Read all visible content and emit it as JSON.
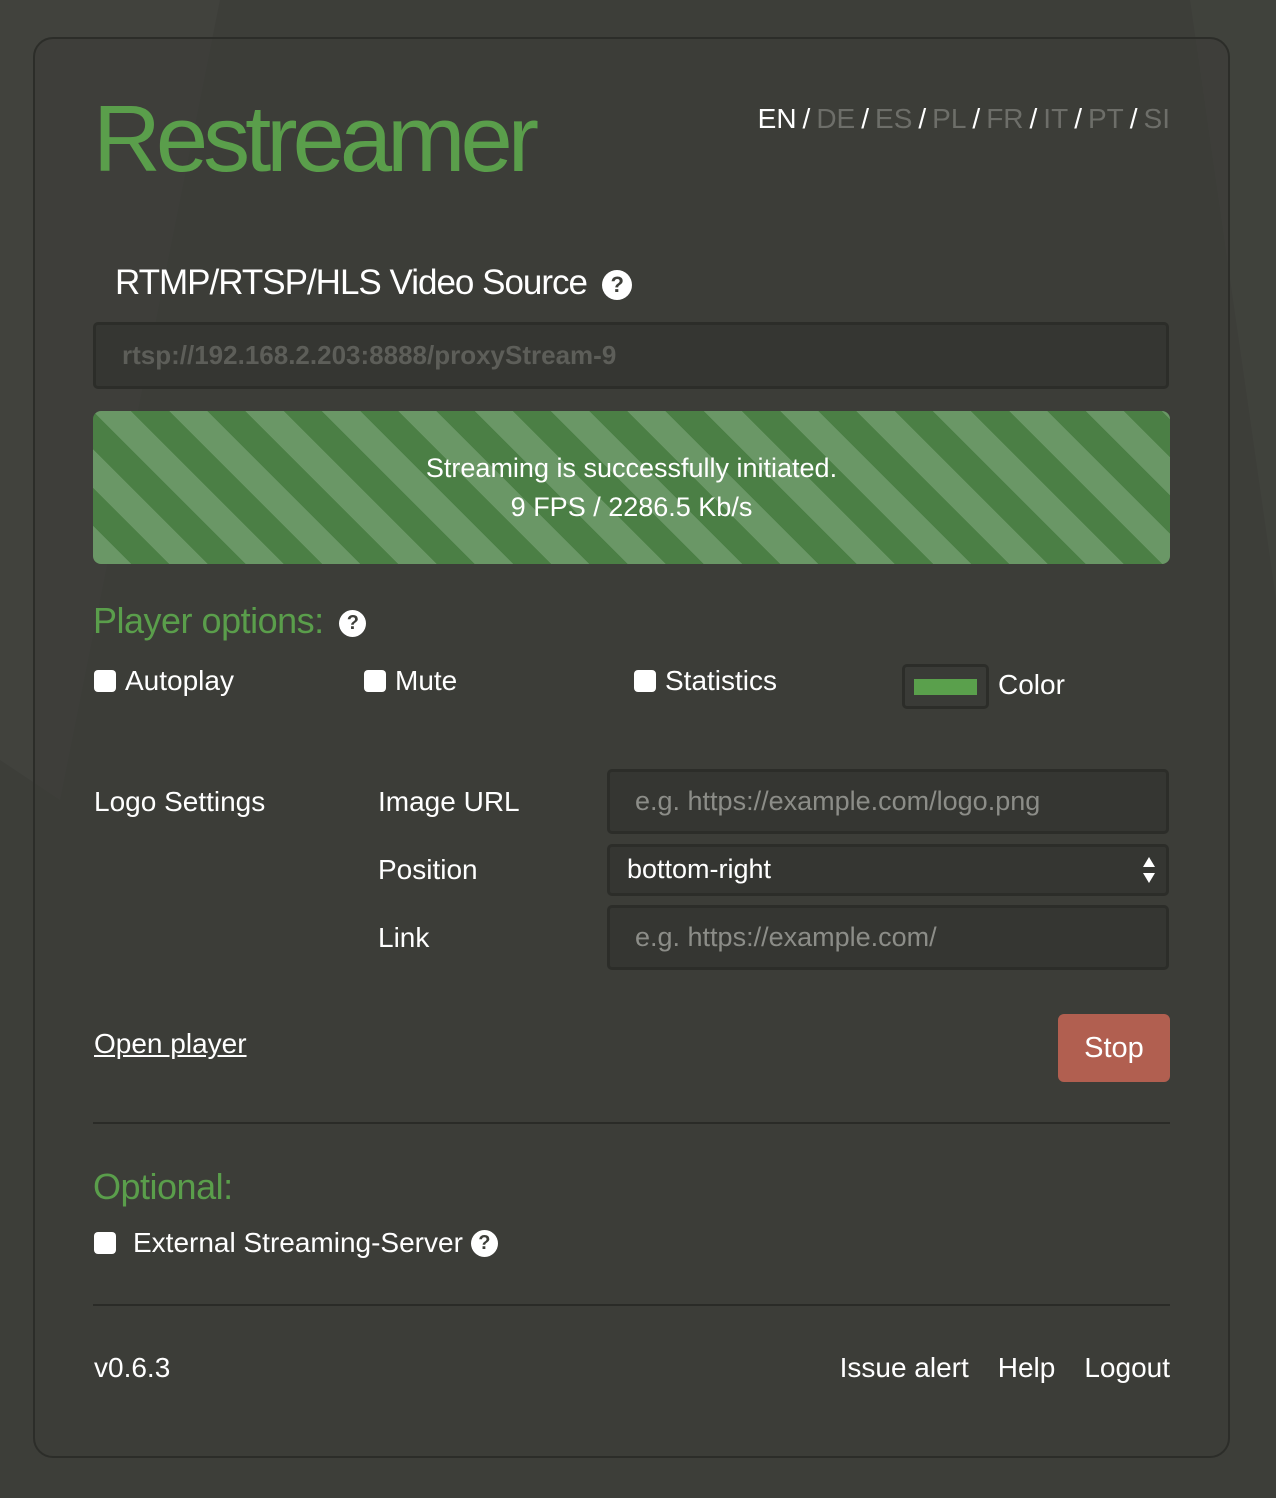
{
  "app": {
    "title": "Restreamer"
  },
  "languages": [
    {
      "code": "EN",
      "active": true
    },
    {
      "code": "DE",
      "active": false
    },
    {
      "code": "ES",
      "active": false
    },
    {
      "code": "PL",
      "active": false
    },
    {
      "code": "FR",
      "active": false
    },
    {
      "code": "IT",
      "active": false
    },
    {
      "code": "PT",
      "active": false
    },
    {
      "code": "SI",
      "active": false
    }
  ],
  "language_separator": "/",
  "video_source": {
    "title": "RTMP/RTSP/HLS Video Source",
    "help_icon": "question-circle-icon",
    "value": "rtsp://192.168.2.203:8888/proxyStream-9"
  },
  "status": {
    "line1": "Streaming is successfully initiated.",
    "line2": "9 FPS / 2286.5 Kb/s",
    "stripe_colors": [
      "#6a9766",
      "#4b7f45"
    ]
  },
  "player_options": {
    "title": "Player options:",
    "autoplay": {
      "label": "Autoplay",
      "checked": false
    },
    "mute": {
      "label": "Mute",
      "checked": false
    },
    "statistics": {
      "label": "Statistics",
      "checked": false
    },
    "color": {
      "label": "Color",
      "value": "#5aa04c"
    }
  },
  "logo_settings": {
    "title": "Logo Settings",
    "image_url": {
      "label": "Image URL",
      "placeholder": "e.g. https://example.com/logo.png",
      "value": ""
    },
    "position": {
      "label": "Position",
      "value": "bottom-right"
    },
    "link": {
      "label": "Link",
      "placeholder": "e.g. https://example.com/",
      "value": ""
    }
  },
  "actions": {
    "open_player": "Open player",
    "stop": "Stop"
  },
  "optional": {
    "title": "Optional:",
    "external_server": {
      "label": "External Streaming-Server",
      "checked": false
    }
  },
  "footer": {
    "version": "v0.6.3",
    "issue_alert": "Issue alert",
    "help": "Help",
    "logout": "Logout"
  },
  "colors": {
    "accent": "#5a9e4b",
    "danger": "#b15f50",
    "background": "#3d3e39"
  }
}
